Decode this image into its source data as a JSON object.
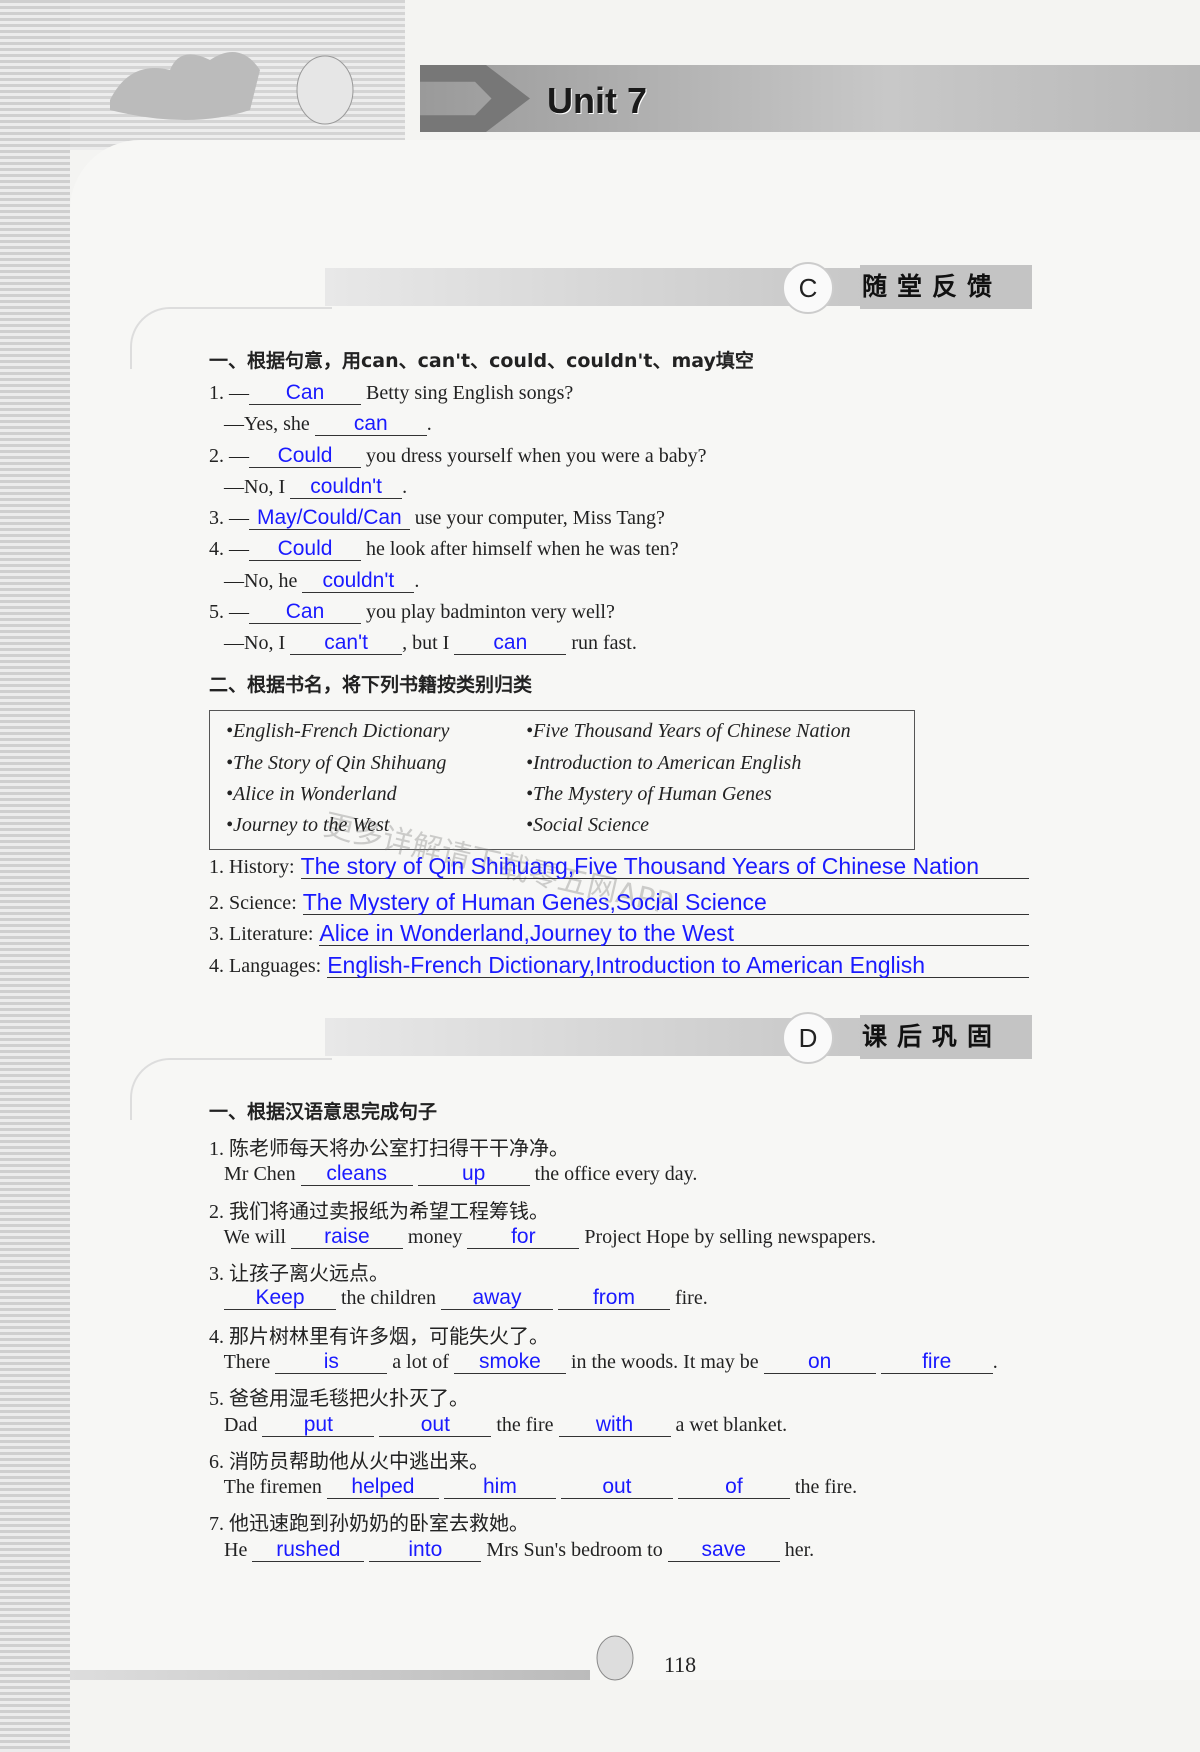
{
  "header": {
    "unit_title": "Unit 7"
  },
  "section_c": {
    "letter": "C",
    "caption": "随堂反馈",
    "part1": {
      "heading": "一、根据句意，用can、can't、could、couldn't、may填空",
      "lines": [
        [
          {
            "t": "1. —"
          },
          {
            "a": "Can"
          },
          {
            "t": " Betty sing English songs?"
          }
        ],
        [
          {
            "t": "   —Yes, she "
          },
          {
            "a": "can"
          },
          {
            "t": "."
          }
        ],
        [
          {
            "t": "2. —"
          },
          {
            "a": "Could"
          },
          {
            "t": " you dress yourself when you were a baby?"
          }
        ],
        [
          {
            "t": "   —No, I "
          },
          {
            "a": "couldn't"
          },
          {
            "t": "."
          }
        ],
        [
          {
            "t": "3. —"
          },
          {
            "a": "May/Could/Can"
          },
          {
            "t": " use your computer, Miss Tang?"
          }
        ],
        [
          {
            "t": "4. —"
          },
          {
            "a": "Could"
          },
          {
            "t": " he look after himself when he was ten?"
          }
        ],
        [
          {
            "t": "   —No, he "
          },
          {
            "a": "couldn't"
          },
          {
            "t": "."
          }
        ],
        [
          {
            "t": "5. —"
          },
          {
            "a": "Can"
          },
          {
            "t": " you play badminton very well?"
          }
        ],
        [
          {
            "t": "   —No, I "
          },
          {
            "a": "can't"
          },
          {
            "t": ", but I "
          },
          {
            "a": "can"
          },
          {
            "t": " run fast."
          }
        ]
      ]
    },
    "part2": {
      "heading": "二、根据书名，将下列书籍按类别归类",
      "books_left": [
        "•English-French Dictionary",
        "•The Story of Qin Shihuang",
        "•Alice in Wonderland",
        "•Journey to the West"
      ],
      "books_right": [
        "•Five Thousand Years of Chinese Nation",
        "•Introduction to American English",
        "•The Mystery of Human Genes",
        "•Social Science"
      ],
      "answers": [
        {
          "label": "1. History:",
          "answer": "The story of Qin Shihuang,Five Thousand Years of Chinese Nation"
        },
        {
          "label": "2. Science:",
          "answer": "The Mystery of Human Genes,Social Science"
        },
        {
          "label": "3. Literature:",
          "answer": "Alice in Wonderland,Journey to the West"
        },
        {
          "label": "4. Languages:",
          "answer": "English-French Dictionary,Introduction to American English"
        }
      ]
    }
  },
  "watermark": "更多详解请下载零五网APP",
  "section_d": {
    "letter": "D",
    "caption": "课后巩固",
    "heading": "一、根据汉语意思完成句子",
    "lines": [
      [
        {
          "t": "1. 陈老师每天将办公室打扫得干干净净。"
        }
      ],
      [
        {
          "t": "   Mr Chen "
        },
        {
          "a": "cleans"
        },
        {
          "t": " "
        },
        {
          "a": "up"
        },
        {
          "t": " the office every day."
        }
      ],
      [
        {
          "t": "2. 我们将通过卖报纸为希望工程筹钱。"
        }
      ],
      [
        {
          "t": "   We will "
        },
        {
          "a": "raise"
        },
        {
          "t": " money "
        },
        {
          "a": "for"
        },
        {
          "t": " Project Hope by selling newspapers."
        }
      ],
      [
        {
          "t": "3. 让孩子离火远点。"
        }
      ],
      [
        {
          "t": "   "
        },
        {
          "a": "Keep"
        },
        {
          "t": " the children "
        },
        {
          "a": "away"
        },
        {
          "t": " "
        },
        {
          "a": "from"
        },
        {
          "t": " fire."
        }
      ],
      [
        {
          "t": "4. 那片树林里有许多烟，可能失火了。"
        }
      ],
      [
        {
          "t": "   There "
        },
        {
          "a": "is"
        },
        {
          "t": " a lot of "
        },
        {
          "a": "smoke"
        },
        {
          "t": " in the woods. It may be "
        },
        {
          "a": "on"
        },
        {
          "t": " "
        },
        {
          "a": "fire"
        },
        {
          "t": "."
        }
      ],
      [
        {
          "t": "5. 爸爸用湿毛毯把火扑灭了。"
        }
      ],
      [
        {
          "t": "   Dad "
        },
        {
          "a": "put"
        },
        {
          "t": " "
        },
        {
          "a": "out"
        },
        {
          "t": " the fire "
        },
        {
          "a": "with"
        },
        {
          "t": " a wet blanket."
        }
      ],
      [
        {
          "t": "6. 消防员帮助他从火中逃出来。"
        }
      ],
      [
        {
          "t": "   The firemen "
        },
        {
          "a": "helped"
        },
        {
          "t": " "
        },
        {
          "a": "him"
        },
        {
          "t": " "
        },
        {
          "a": "out"
        },
        {
          "t": " "
        },
        {
          "a": "of"
        },
        {
          "t": " the fire."
        }
      ],
      [
        {
          "t": "7. 他迅速跑到孙奶奶的卧室去救她。"
        }
      ],
      [
        {
          "t": "   He "
        },
        {
          "a": "rushed"
        },
        {
          "t": " "
        },
        {
          "a": "into"
        },
        {
          "t": " Mrs Sun's bedroom to "
        },
        {
          "a": "save"
        },
        {
          "t": " her."
        }
      ]
    ]
  },
  "footer": {
    "page_number": "118"
  },
  "colors": {
    "answer": "#1a1aff"
  }
}
